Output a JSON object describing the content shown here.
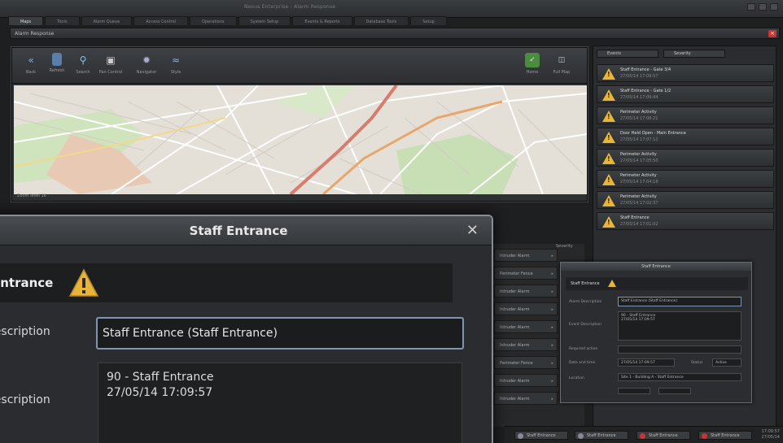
{
  "window": {
    "title": "Nexus Enterprise - Alarm Response"
  },
  "tabs": [
    "Maps",
    "Tools",
    "Alarm Queue",
    "Access Control",
    "Operations",
    "System Setup",
    "Events & Reports",
    "Database Tools",
    "Setup"
  ],
  "app_bar": {
    "title": "Alarm Response"
  },
  "map_toolbar": {
    "tools": [
      "Back",
      "Refresh",
      "Search",
      "Pan Control",
      "Navigator",
      "Style"
    ],
    "right_tools": [
      "Home",
      "Full Map"
    ]
  },
  "map_status": "Zoom level 16",
  "event_filters": {
    "left": "Events",
    "right": "Severity"
  },
  "events": [
    {
      "name": "Staff Entrance - Gate 3/4",
      "time": "27/05/14 17:09:57"
    },
    {
      "name": "Staff Entrance - Gate 1/2",
      "time": "27/05/14 17:09:44"
    },
    {
      "name": "Perimeter Activity",
      "time": "27/05/14 17:08:21"
    },
    {
      "name": "Door Held Open - Main Entrance",
      "time": "27/05/14 17:07:12"
    },
    {
      "name": "Perimeter Activity",
      "time": "27/05/14 17:05:50"
    },
    {
      "name": "Perimeter Activity",
      "time": "27/05/14 17:04:18"
    },
    {
      "name": "Perimeter Activity",
      "time": "27/05/14 17:02:37"
    },
    {
      "name": "Staff Entrance",
      "time": "27/05/14 17:01:02"
    }
  ],
  "mid_list": {
    "header": "Severity",
    "rows": [
      "Intruder Alarm",
      "Perimeter Fence",
      "Intruder Alarm",
      "Intruder Alarm",
      "Intruder Alarm",
      "Intruder Alarm",
      "Perimeter Fence",
      "Intruder Alarm",
      "Intruder Alarm"
    ]
  },
  "small_dialog": {
    "title": "Staff Entrance",
    "name": "Staff Entrance",
    "labels": {
      "alarm_description": "Alarm Description",
      "event_description": "Event Description",
      "required_action": "Required action",
      "date_time": "Date and time",
      "location": "Location",
      "status": "Status"
    },
    "alarm_description": "Staff Entrance (Staff Entrance)",
    "event_description": [
      "90 - Staff Entrance",
      "27/05/14 17:09:57"
    ],
    "date_time": "27/05/14 17:09:57",
    "status": "Active",
    "location": "Site 1 - Building A - Staff Entrance"
  },
  "bottom_bar": {
    "buttons": [
      "Staff Entrance",
      "Staff Entrance",
      "Staff Entrance",
      "Staff Entrance"
    ],
    "clock": [
      "17:09:57",
      "27/05/14"
    ]
  },
  "dialog": {
    "title": "Staff Entrance",
    "name": "Entrance",
    "alarm_description_label": "Description",
    "alarm_description": "Staff Entrance (Staff Entrance)",
    "event_description_label": "Description",
    "event_description_line1": "90 - Staff Entrance",
    "event_description_line2": "27/05/14 17:09:57"
  },
  "colors": {
    "warning": "#e8b43a",
    "field_border": "#7f96b2",
    "close_red": "#cc3333"
  }
}
